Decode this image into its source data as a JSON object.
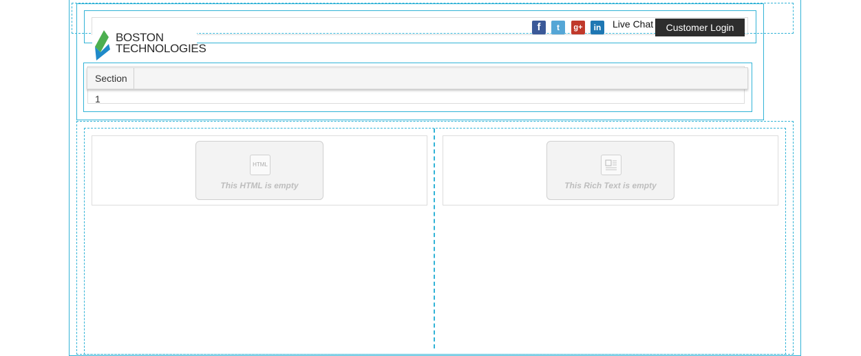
{
  "header": {
    "logo": {
      "line1": "BOSTON",
      "line2": "TECHNOLOGIES"
    },
    "social": [
      {
        "name": "facebook",
        "glyph": "f",
        "color": "#3b5998"
      },
      {
        "name": "twitter",
        "glyph": "t",
        "color": "#55a6d6"
      },
      {
        "name": "google-plus",
        "glyph": "g+",
        "color": "#c0392b"
      },
      {
        "name": "linkedin",
        "glyph": "in",
        "color": "#1e77b3"
      }
    ],
    "live_chat": "Live Chat",
    "login_label": "Customer Login"
  },
  "nav": {
    "items": [
      "Section 1"
    ]
  },
  "content": {
    "html_empty": {
      "icon_label": "HTML",
      "text": "This HTML is empty"
    },
    "richtext_empty": {
      "text": "This Rich Text is empty"
    }
  },
  "colors": {
    "guide": "#2fb2d6",
    "login_bg": "#2d2d2d",
    "logo_green": "#4caf50",
    "logo_blue": "#1f8ac9"
  }
}
